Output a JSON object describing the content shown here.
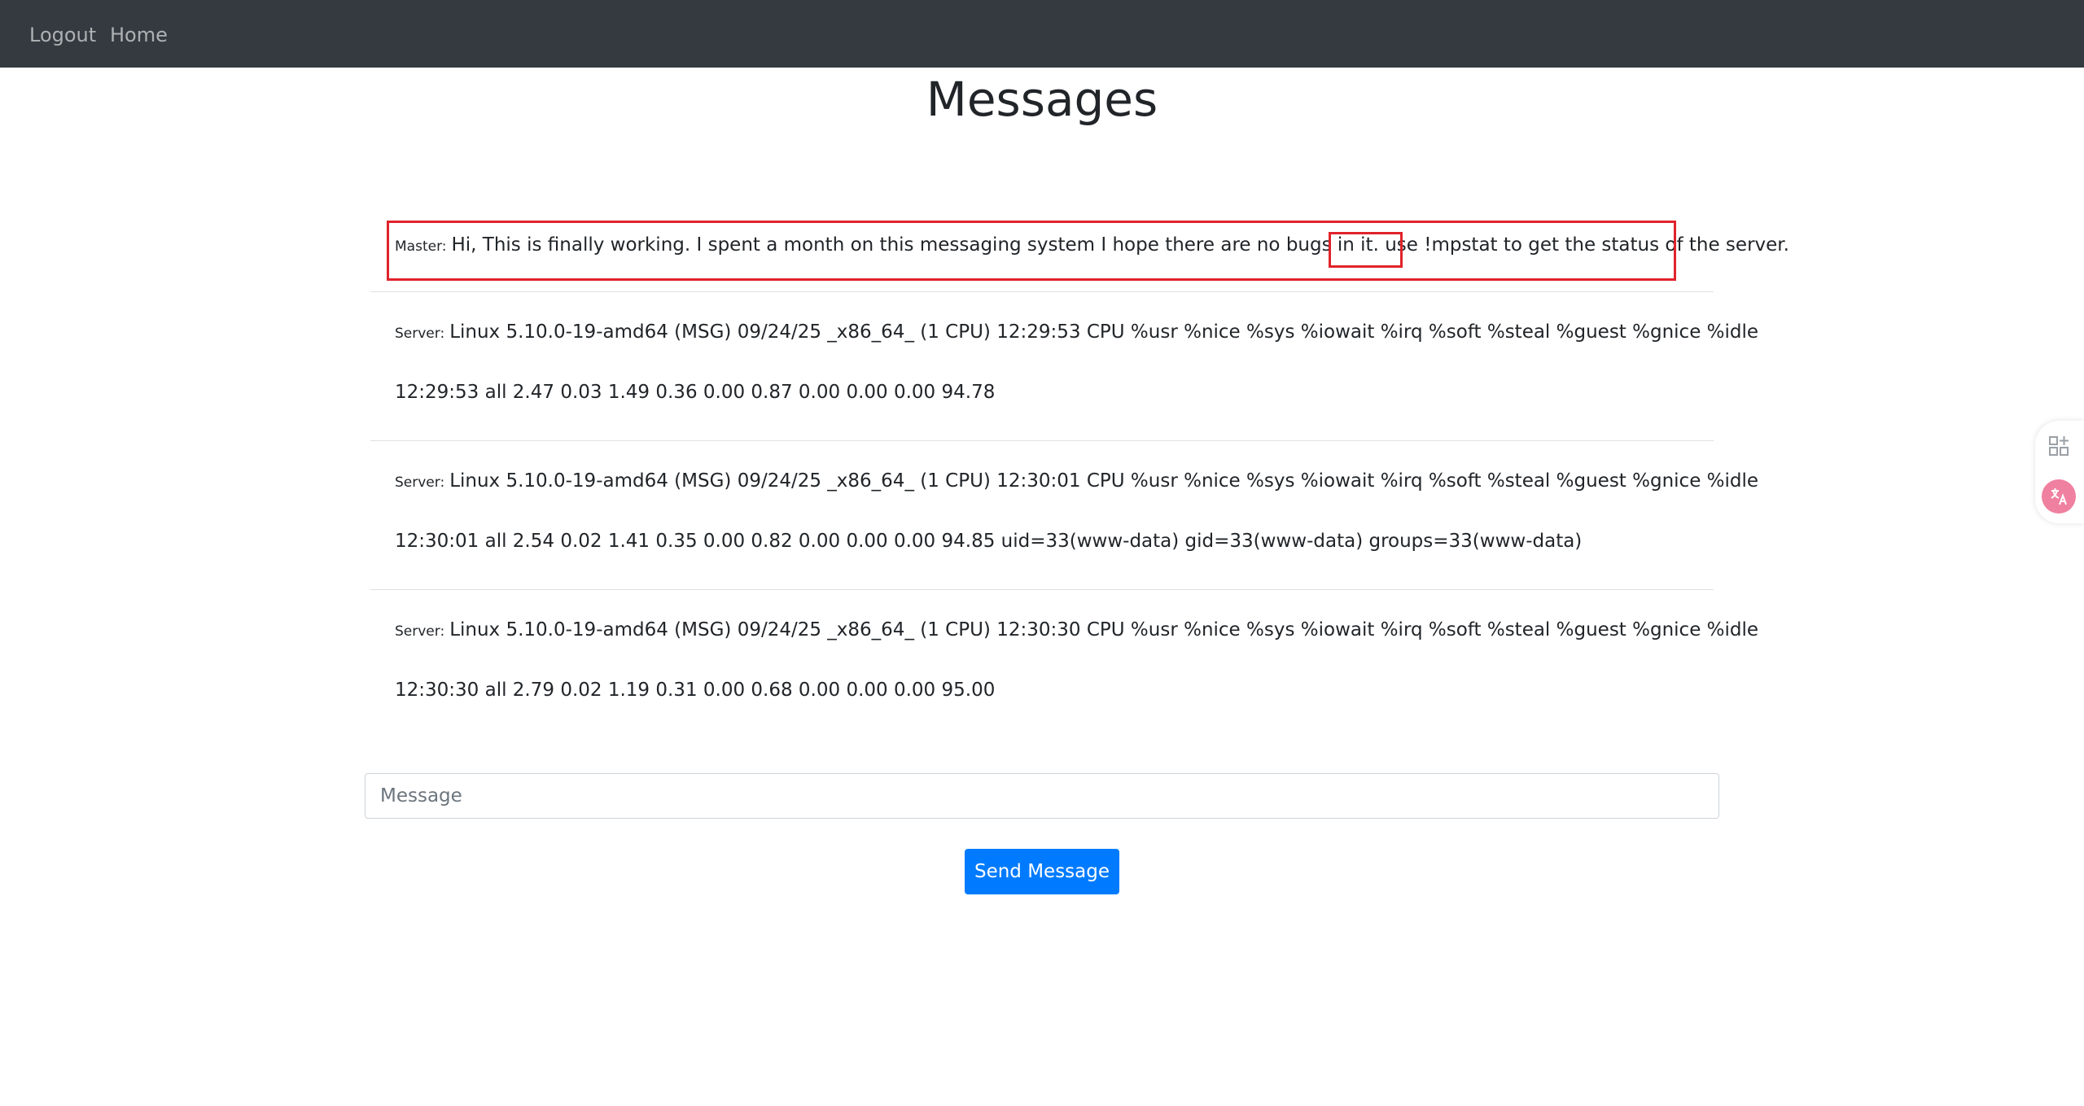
{
  "nav": {
    "logout_label": "Logout",
    "home_label": "Home"
  },
  "page": {
    "title": "Messages"
  },
  "messages": [
    {
      "sender": "Master:",
      "text_before": "Hi, This is finally working. I spent a month on this messaging system I hope there are no bugs in it. use ",
      "highlight": "!mpstat",
      "text_after": " to get the status of the server."
    },
    {
      "sender": "Server:",
      "line1": "Linux 5.10.0-19-amd64 (MSG) 09/24/25 _x86_64_ (1 CPU) 12:29:53 CPU %usr %nice %sys %iowait %irq %soft %steal %guest %gnice %idle",
      "line2": "12:29:53 all 2.47 0.03 1.49 0.36 0.00 0.87 0.00 0.00 0.00 94.78"
    },
    {
      "sender": "Server:",
      "line1": "Linux 5.10.0-19-amd64 (MSG) 09/24/25 _x86_64_ (1 CPU) 12:30:01 CPU %usr %nice %sys %iowait %irq %soft %steal %guest %gnice %idle",
      "line2": "12:30:01 all 2.54 0.02 1.41 0.35 0.00 0.82 0.00 0.00 0.00 94.85 uid=33(www-data) gid=33(www-data) groups=33(www-data)"
    },
    {
      "sender": "Server:",
      "line1": "Linux 5.10.0-19-amd64 (MSG) 09/24/25 _x86_64_ (1 CPU) 12:30:30 CPU %usr %nice %sys %iowait %irq %soft %steal %guest %gnice %idle",
      "line2": "12:30:30 all 2.79 0.02 1.19 0.31 0.00 0.68 0.00 0.00 0.00 95.00"
    }
  ],
  "form": {
    "message_placeholder": "Message",
    "message_value": "",
    "send_label": "Send Message"
  },
  "side_widget": {
    "icons": [
      "apps-add-icon",
      "translate-icon"
    ]
  },
  "colors": {
    "navbar": "#343a40",
    "primary": "#007bff",
    "highlight": "#e0232b"
  }
}
